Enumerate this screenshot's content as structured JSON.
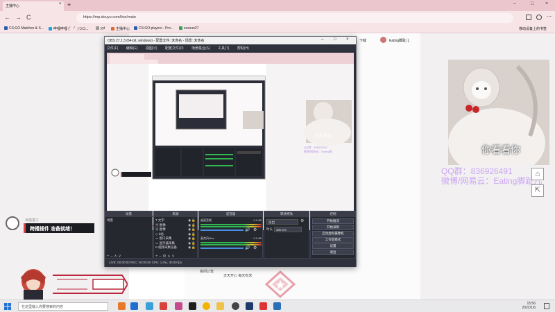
{
  "browser": {
    "tab_title": "主播中心",
    "tab_close": "×",
    "new_tab": "+",
    "window_controls": [
      "–",
      "□",
      "×"
    ],
    "url": "https://mp.douyu.com/live/main",
    "nav": {
      "back": "←",
      "forward": "→",
      "reload": "C"
    },
    "bookmarks": [
      {
        "label": "CS:GO Matches & S...",
        "color": "#2a5aa8"
      },
      {
        "label": "哔哩哔哩 (゜-゜)つロ...",
        "color": "#1ea0d8"
      },
      {
        "label": "yyt",
        "color": "#999999"
      },
      {
        "label": "主播中心",
        "color": "#e06a2b"
      },
      {
        "label": "CS:GO players - Pro...",
        "color": "#2a5aa8"
      },
      {
        "label": "zoxxun27",
        "color": "#3b9f5a"
      }
    ],
    "bookmark_right": "移动设备上的书签",
    "page_download": "下载",
    "page_user": "Eating脚趾儿"
  },
  "obs": {
    "title": "OBS 27.1.3 (64-bit, windows) - 配置文件: 未命名 - 场景: 未命名",
    "menu": [
      "文件(F)",
      "编辑(E)",
      "视图(V)",
      "配置文件(P)",
      "场景集合(S)",
      "工具(T)",
      "帮助(H)"
    ],
    "no_source": "未选择源",
    "props_button": "属性",
    "filters_button": "滤镜",
    "docks": {
      "scenes": "场景",
      "sources": "来源",
      "mixer": "混音器",
      "transitions": "转场特效",
      "controls": "控制"
    },
    "scene_items": [
      "场景"
    ],
    "source_items": [
      "文字",
      "图像",
      "图像",
      "b站",
      "窗口采集",
      "显示器采集",
      "视频采集设备"
    ],
    "mixer": [
      {
        "name": "桌面音频",
        "db": "0.0 dB"
      },
      {
        "name": "麦克风/Aux",
        "db": "0.0 dB"
      }
    ],
    "transition": "淡出",
    "duration_label": "时长",
    "duration_value": "300 ms",
    "controls": [
      "开始推流",
      "开始录制",
      "启动虚拟摄像机",
      "工作室模式",
      "设置",
      "退出"
    ],
    "status": "LIVE: 00:00:00    REC: 00:00:00    CPU: 1.0%, 30.00 fps"
  },
  "page": {
    "plugin_banner": "跨播插件 准备就绪！",
    "plugin_name": "海猫猫子",
    "announce_label": "房间公告:",
    "announce_text": "天天开心 每天有米"
  },
  "sticker": {
    "caption": "你看看你",
    "qq": "QQ群：836926491",
    "weibo": "微博/网易云：Eating脚趾儿"
  },
  "taskbar": {
    "search_placeholder": "在这里输入你要搜索的内容",
    "time": "15:56",
    "date": "2022/1/6",
    "icons": [
      "#e8782a",
      "#1f6fd1",
      "#3aa0d8",
      "#d8423a",
      "#c64b8c",
      "#1e1e1e",
      "#f2b400",
      "#f0c24a",
      "#444444",
      "#1c3a6a",
      "#d33",
      "#2a6db8"
    ]
  }
}
